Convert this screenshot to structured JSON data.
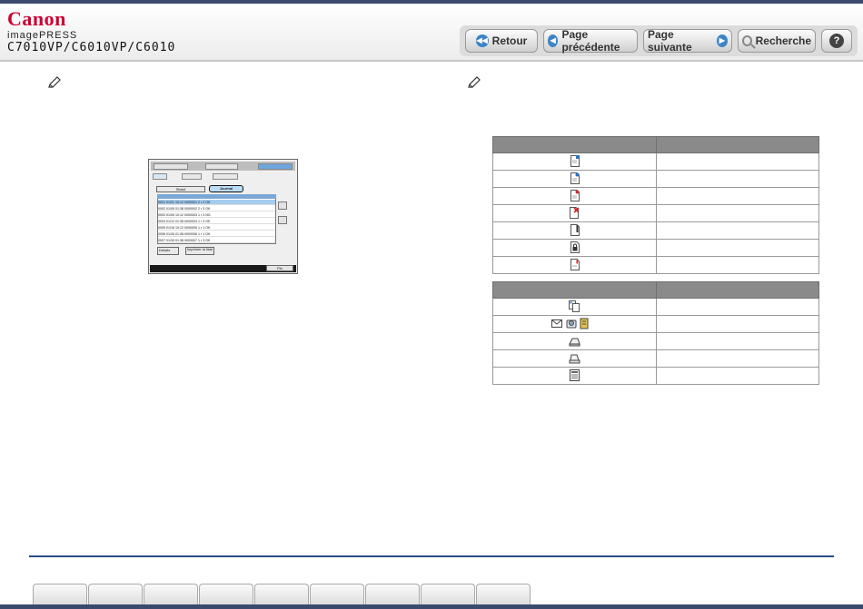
{
  "brand": {
    "logo": "Canon",
    "product": "imagePRESS",
    "model": "C7010VP/C6010VP/C6010"
  },
  "nav": {
    "back_label": "Retour",
    "prev_label": "Page précédente",
    "next_label": "Page suivante",
    "search_label": "Recherche",
    "help_label": "?"
  },
  "screenshot": {
    "journal_label": "Journal",
    "status_label": "Statut",
    "details_label": "Détails",
    "print_label": "Imprimer la liste",
    "close_label": "Fin",
    "rows": [
      "0001  01/01 10:12  0000001    2 ▪   2    OK",
      "0002  01/05 01:38  0000002    2 ▪   3    OK",
      "0003  01/05 10:12  0000003    1 ▪   3    NG",
      "0004  01/12 01:38  0000004    1 ▪   3    OK",
      "0005  01/16 10:12  0000005    1 ▪   1    OK",
      "0006  01/26 01:38  0000006    1 ▪   1    OK",
      "0007  01/30 01:38  0000007    1 ▪   3    OK"
    ]
  },
  "status_table": {
    "icons": [
      "doc-blue-icon",
      "doc-blue-dot-icon",
      "doc-red-dot-icon",
      "doc-x-icon",
      "doc-bar-icon",
      "doc-lock-icon",
      "doc-red-mark-icon"
    ]
  },
  "type_table": {
    "icons": [
      "copy-stack-icon",
      "fax-network-icon",
      "printer-tray-icon",
      "printer-icon",
      "calculator-icon"
    ]
  },
  "footer": {
    "tabs": [
      "",
      "",
      "",
      "",
      "",
      "",
      "",
      "",
      ""
    ]
  }
}
